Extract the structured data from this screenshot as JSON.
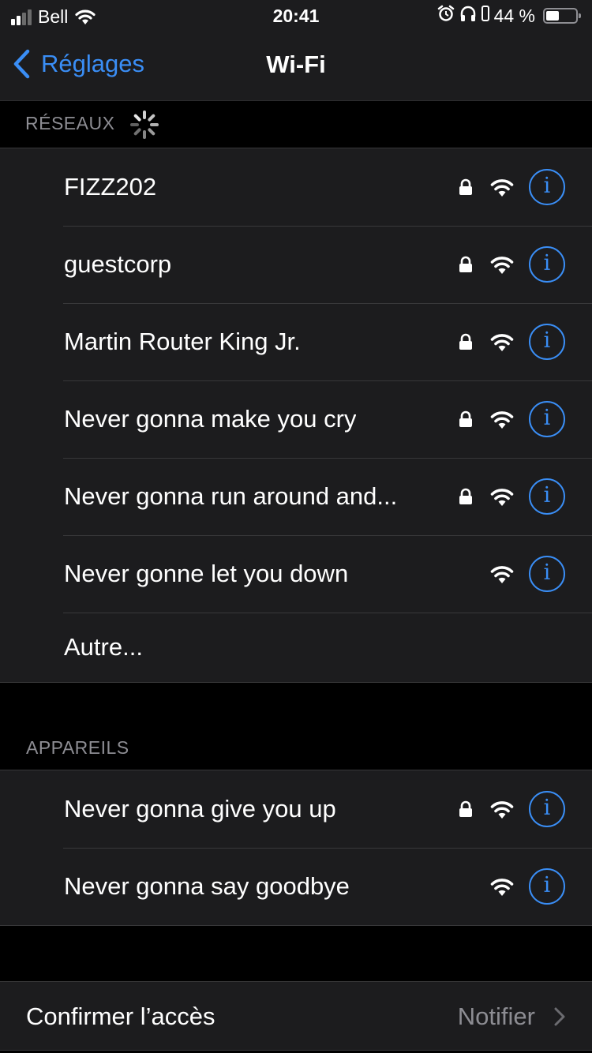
{
  "status_bar": {
    "carrier": "Bell",
    "time": "20:41",
    "battery_percent_label": "44 %",
    "battery_level": 0.44,
    "icons": [
      "cellular-signal-icon",
      "wifi-icon",
      "alarm-icon",
      "headphones-icon",
      "portrait-lock-icon",
      "battery-icon"
    ]
  },
  "nav": {
    "back_label": "Réglages",
    "title": "Wi-Fi"
  },
  "networks_section": {
    "header": "RÉSEAUX",
    "items": [
      {
        "name": "FIZZ202",
        "secured": true
      },
      {
        "name": "guestcorp",
        "secured": true
      },
      {
        "name": "Martin Router King Jr.",
        "secured": true
      },
      {
        "name": "Never gonna make you cry",
        "secured": true
      },
      {
        "name": "Never gonna run around and...",
        "secured": true
      },
      {
        "name": "Never gonne let you down",
        "secured": false
      }
    ],
    "other_label": "Autre..."
  },
  "devices_section": {
    "header": "APPAREILS",
    "items": [
      {
        "name": "Never gonna give you up",
        "secured": true
      },
      {
        "name": "Never gonna say goodbye",
        "secured": false
      }
    ]
  },
  "confirm_access": {
    "label": "Confirmer l’accès",
    "value": "Notifier"
  },
  "colors": {
    "accent": "#3a8ef6",
    "background": "#000000",
    "cell": "#1c1c1e",
    "secondary_text": "#8d8d93"
  }
}
